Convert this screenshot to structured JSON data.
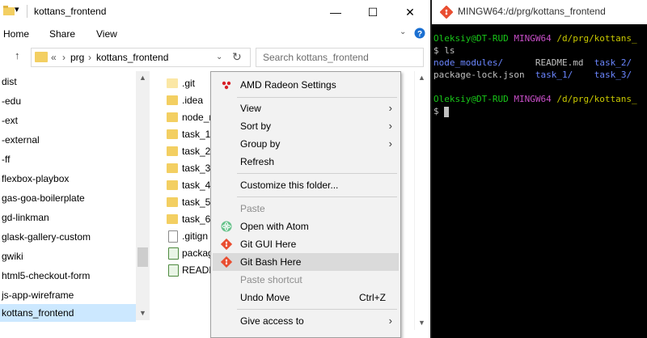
{
  "explorer": {
    "window_title": "kottans_frontend",
    "ribbon_tabs": [
      "Home",
      "Share",
      "View"
    ],
    "address": {
      "overflow": "«",
      "crumbs": [
        "prg",
        "kottans_frontend"
      ]
    },
    "search_placeholder": "Search kottans_frontend",
    "nav_items": [
      "dist",
      "-edu",
      "-ext",
      "-external",
      "-ff",
      "flexbox-playbox",
      "gas-goa-boilerplate",
      "gd-linkman",
      "glask-gallery-custom",
      "gwiki",
      "html5-checkout-form",
      "js-app-wireframe",
      "kottans_frontend"
    ],
    "selected_nav": "kottans_frontend",
    "files": [
      {
        "name": ".git",
        "icon": "folder-light"
      },
      {
        "name": ".idea",
        "icon": "folder"
      },
      {
        "name": "node_m",
        "icon": "folder"
      },
      {
        "name": "task_1",
        "icon": "folder"
      },
      {
        "name": "task_2",
        "icon": "folder"
      },
      {
        "name": "task_3",
        "icon": "folder"
      },
      {
        "name": "task_4",
        "icon": "folder"
      },
      {
        "name": "task_5",
        "icon": "folder"
      },
      {
        "name": "task_6",
        "icon": "folder"
      },
      {
        "name": ".gitign",
        "icon": "document"
      },
      {
        "name": "packag",
        "icon": "notepad"
      },
      {
        "name": "READM",
        "icon": "notepad"
      }
    ]
  },
  "context_menu": {
    "items": [
      {
        "label": "AMD Radeon Settings",
        "icon": "amd-radeon-icon"
      },
      {
        "label": "View",
        "submenu": true
      },
      {
        "label": "Sort by",
        "submenu": true
      },
      {
        "label": "Group by",
        "submenu": true
      },
      {
        "label": "Refresh"
      },
      {
        "label": "Customize this folder..."
      },
      {
        "label": "Paste",
        "disabled": true
      },
      {
        "label": "Open with Atom",
        "icon": "atom-icon"
      },
      {
        "label": "Git GUI Here",
        "icon": "git-icon"
      },
      {
        "label": "Git Bash Here",
        "icon": "git-icon",
        "highlighted": true
      },
      {
        "label": "Paste shortcut",
        "disabled": true
      },
      {
        "label": "Undo Move",
        "shortcut": "Ctrl+Z"
      },
      {
        "label": "Give access to",
        "submenu": true
      }
    ]
  },
  "terminal": {
    "title": "MINGW64:/d/prg/kottans_frontend",
    "prompt1": {
      "user": "Oleksiy@DT-RUD",
      "env": "MINGW64",
      "path": "/d/prg/kottans_"
    },
    "cmd1": "$ ls",
    "ls_row1": {
      "a": "node_modules/",
      "b": "README.md",
      "c": "task_2/"
    },
    "ls_row2": {
      "a": "package-lock.json",
      "b": "task_1/",
      "c": "task_3/"
    },
    "prompt2": {
      "user": "Oleksiy@DT-RUD",
      "env": "MINGW64",
      "path": "/d/prg/kottans_"
    },
    "cmd2": "$ "
  },
  "colors": {
    "selection": "#cce8ff",
    "menu_bg": "#f2f2f2",
    "menu_highlight": "#dadada",
    "terminal_bg": "#000000",
    "prompt_green": "#19c519",
    "prompt_magenta": "#c84ec8",
    "path_yellow": "#c8c800",
    "dir_blue": "#6b86ff"
  }
}
